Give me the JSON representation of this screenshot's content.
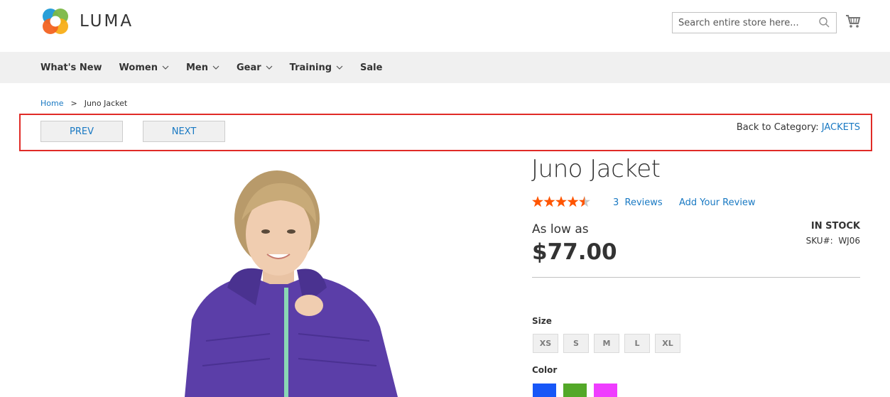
{
  "header": {
    "logo_text": "LUMA",
    "search_placeholder": "Search entire store here...",
    "logo_colors": [
      "#f26322",
      "#7bb846",
      "#1e9ad6",
      "#f8ae18"
    ]
  },
  "nav": {
    "items": [
      {
        "label": "What's New",
        "has_dropdown": false
      },
      {
        "label": "Women",
        "has_dropdown": true
      },
      {
        "label": "Men",
        "has_dropdown": true
      },
      {
        "label": "Gear",
        "has_dropdown": true
      },
      {
        "label": "Training",
        "has_dropdown": true
      },
      {
        "label": "Sale",
        "has_dropdown": false
      }
    ]
  },
  "breadcrumb": {
    "home": "Home",
    "separator": ">",
    "current": "Juno Jacket"
  },
  "pager": {
    "prev_label": "PREV",
    "next_label": "NEXT",
    "back_prefix": "Back to Category:",
    "back_category": "JACKETS"
  },
  "product": {
    "title": "Juno Jacket",
    "rating": 4.5,
    "rating_max": 5,
    "reviews_count": "3",
    "reviews_label": "Reviews",
    "add_review": "Add Your Review",
    "price_prefix": "As low as",
    "price": "$77.00",
    "stock": "IN STOCK",
    "sku_label": "SKU#:",
    "sku": "WJ06",
    "size_label": "Size",
    "sizes": [
      "XS",
      "S",
      "M",
      "L",
      "XL"
    ],
    "color_label": "Color",
    "colors": [
      "#1857f7",
      "#53a828",
      "#ef3dff"
    ]
  },
  "colors": {
    "link": "#1979c3",
    "star": "#ff5501",
    "star_empty": "#c7c7c7",
    "highlight_border": "#e02b27"
  }
}
